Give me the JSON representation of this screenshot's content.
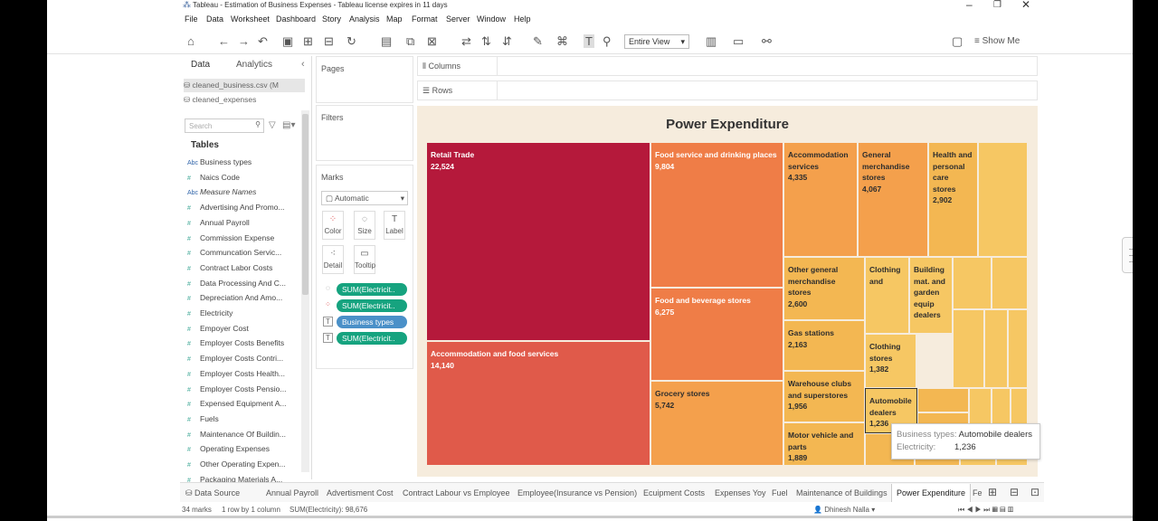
{
  "window": {
    "title": "Tableau - Estimation of Business Expenses - Tableau license expires in 11 days"
  },
  "menu": [
    "File",
    "Data",
    "Worksheet",
    "Dashboard",
    "Story",
    "Analysis",
    "Map",
    "Format",
    "Server",
    "Window",
    "Help"
  ],
  "toolbar": {
    "fit_value": "Entire View",
    "show_me": "Show Me"
  },
  "left_pane": {
    "tabs": [
      "Data",
      "Analytics"
    ],
    "sources": [
      "cleaned_business.csv (M",
      "cleaned_expenses"
    ],
    "search_placeholder": "Search",
    "tables_label": "Tables",
    "fields": [
      {
        "type": "Abc",
        "name": "Business types"
      },
      {
        "type": "#",
        "name": "Naics Code"
      },
      {
        "type": "Abc",
        "name": "Measure Names"
      },
      {
        "type": "#",
        "name": "Advertising And Promo..."
      },
      {
        "type": "#",
        "name": "Annual Payroll"
      },
      {
        "type": "#",
        "name": "Commission Expense"
      },
      {
        "type": "#",
        "name": "Communcation Servic..."
      },
      {
        "type": "#",
        "name": "Contract Labor Costs"
      },
      {
        "type": "#",
        "name": "Data Processing And C..."
      },
      {
        "type": "#",
        "name": "Depreciation And Amo..."
      },
      {
        "type": "#",
        "name": "Electricity"
      },
      {
        "type": "#",
        "name": "Empoyer Cost"
      },
      {
        "type": "#",
        "name": "Employer Costs Benefits"
      },
      {
        "type": "#",
        "name": "Employer Costs Contri..."
      },
      {
        "type": "#",
        "name": "Employer Costs Health..."
      },
      {
        "type": "#",
        "name": "Employer Costs Pensio..."
      },
      {
        "type": "#",
        "name": "Expensed Equipment A..."
      },
      {
        "type": "#",
        "name": "Fuels"
      },
      {
        "type": "#",
        "name": "Maintenance Of Buildin..."
      },
      {
        "type": "#",
        "name": "Operating Expenses"
      },
      {
        "type": "#",
        "name": "Other Operating Expen..."
      },
      {
        "type": "#",
        "name": "Packaging Materials A..."
      }
    ]
  },
  "shelves": {
    "pages": "Pages",
    "filters": "Filters",
    "marks": "Marks",
    "columns": "Columns",
    "rows": "Rows"
  },
  "marks": {
    "type": "Automatic",
    "buttons": [
      "Color",
      "Size",
      "Label",
      "Detail",
      "Tooltip"
    ],
    "pills": [
      "SUM(Electricit..",
      "SUM(Electricit..",
      "Business types",
      "SUM(Electricit.."
    ]
  },
  "viz": {
    "title": "Power Expenditure",
    "cells": [
      {
        "name": "Retail Trade",
        "value": "22,524"
      },
      {
        "name": "Accommodation and food services",
        "value": "14,140"
      },
      {
        "name": "Food service and drinking places",
        "value": "9,804"
      },
      {
        "name": "Food and beverage stores",
        "value": "6,275"
      },
      {
        "name": "Grocery stores",
        "value": "5,742"
      },
      {
        "name": "Accommodation services",
        "value": "4,335"
      },
      {
        "name": "General merchandise stores",
        "value": "4,067"
      },
      {
        "name": "Health and personal care stores",
        "value": "2,902"
      },
      {
        "name": "Other general merchandise stores",
        "value": "2,600"
      },
      {
        "name": "Gas stations",
        "value": "2,163"
      },
      {
        "name": "Warehouse clubs and superstores",
        "value": "1,956"
      },
      {
        "name": "Motor vehicle and parts",
        "value": "1,889"
      },
      {
        "name": "Clothing and",
        "value": ""
      },
      {
        "name": "Building mat. and garden equip dealers",
        "value": ""
      },
      {
        "name": "Clothing stores",
        "value": "1,382"
      },
      {
        "name": "Automobile dealers",
        "value": "1,236"
      }
    ],
    "colors": {
      "retail": "#b5193b",
      "accom": "#e05a4a",
      "food": "#ef7d47",
      "mid": "#f4a04c",
      "light": "#f3b752",
      "lighter": "#f6c763"
    }
  },
  "tooltip": {
    "k1": "Business types:",
    "v1": "Automobile dealers",
    "k2": "Electricity:",
    "v2": "1,236"
  },
  "sheet_tabs": [
    "Data Source",
    "Annual Payroll",
    "Advertisment Cost",
    "Contract Labour vs Employee",
    "Employee(Insurance vs Pension)",
    "Ecuipment Costs",
    "Expenses Yoy",
    "Fuel",
    "Maintenance of Buildings",
    "Power Expenditure",
    "Fe"
  ],
  "status": {
    "marks": "34 marks",
    "rows": "1 row by 1 column",
    "sum": "SUM(Electricity): 98,676",
    "user": "Dhinesh Nalla"
  }
}
